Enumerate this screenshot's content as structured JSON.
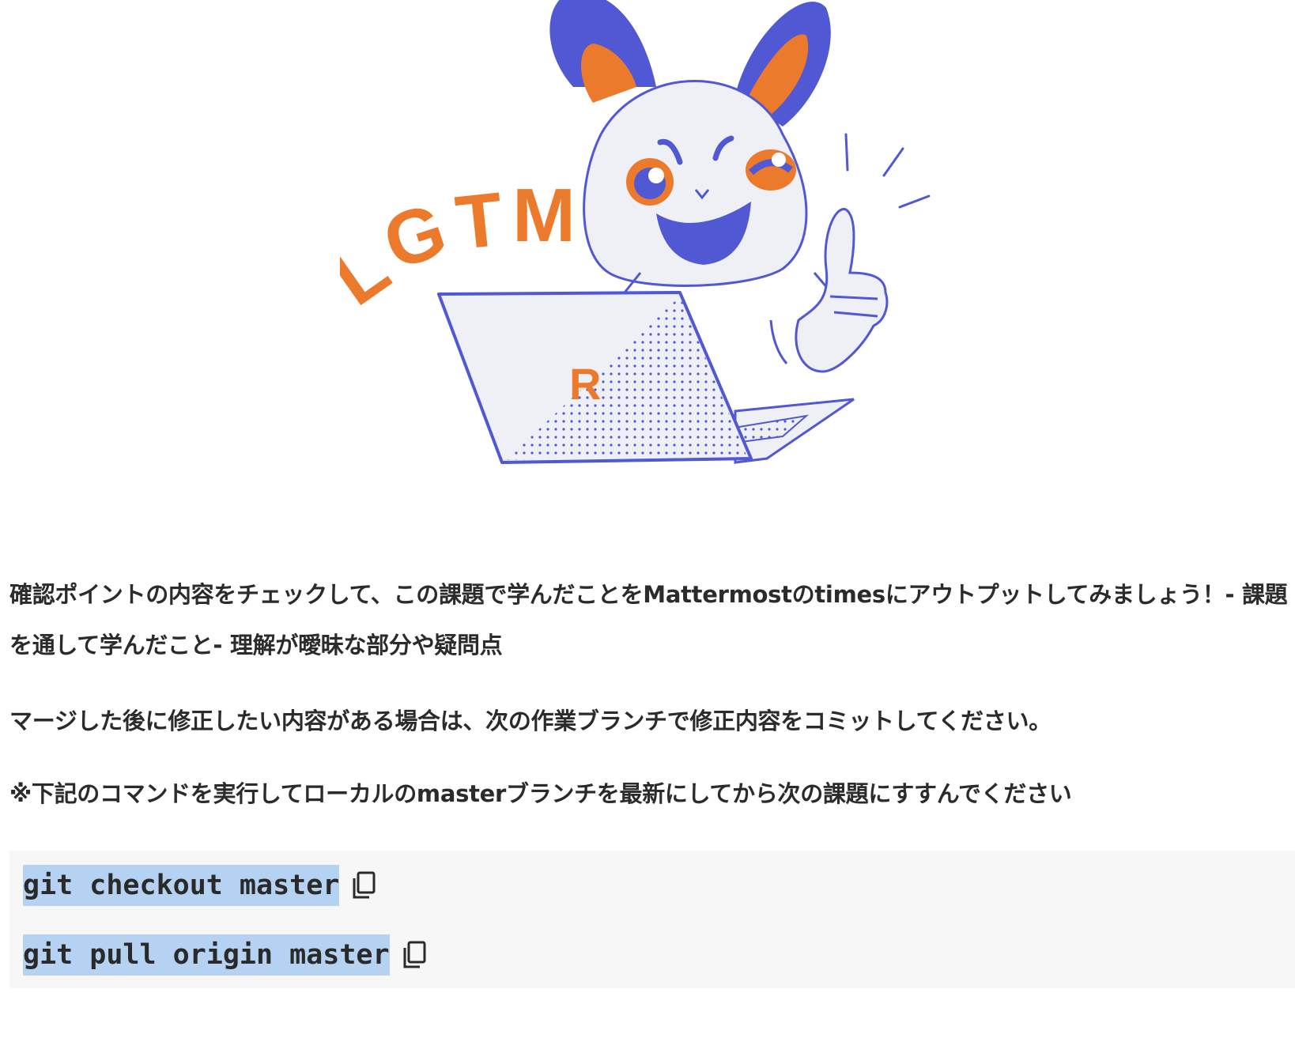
{
  "mascot": {
    "badge_text": "LGTM",
    "laptop_logo": "R",
    "icon": "lgtm-mascot-illustration"
  },
  "paragraphs": {
    "p1": "確認ポイントの内容をチェックして、この課題で学んだことをMattermostのtimesにアウトプットしてみましょう！- 課題を通して学んだこと- 理解が曖昧な部分や疑問点",
    "p2": "マージした後に修正したい内容がある場合は、次の作業ブランチで修正内容をコミットしてください。",
    "p3": "※下記のコマンドを実行してローカルのmasterブランチを最新にしてから次の課題にすすんでください"
  },
  "code": {
    "line1": "git checkout master",
    "line2": "git pull origin master",
    "copy_icon": "copy-icon"
  },
  "colors": {
    "orange": "#ec7a2c",
    "purple": "#5058d4",
    "code_highlight": "#b6d2f3",
    "code_bg": "#f7f7f7"
  }
}
